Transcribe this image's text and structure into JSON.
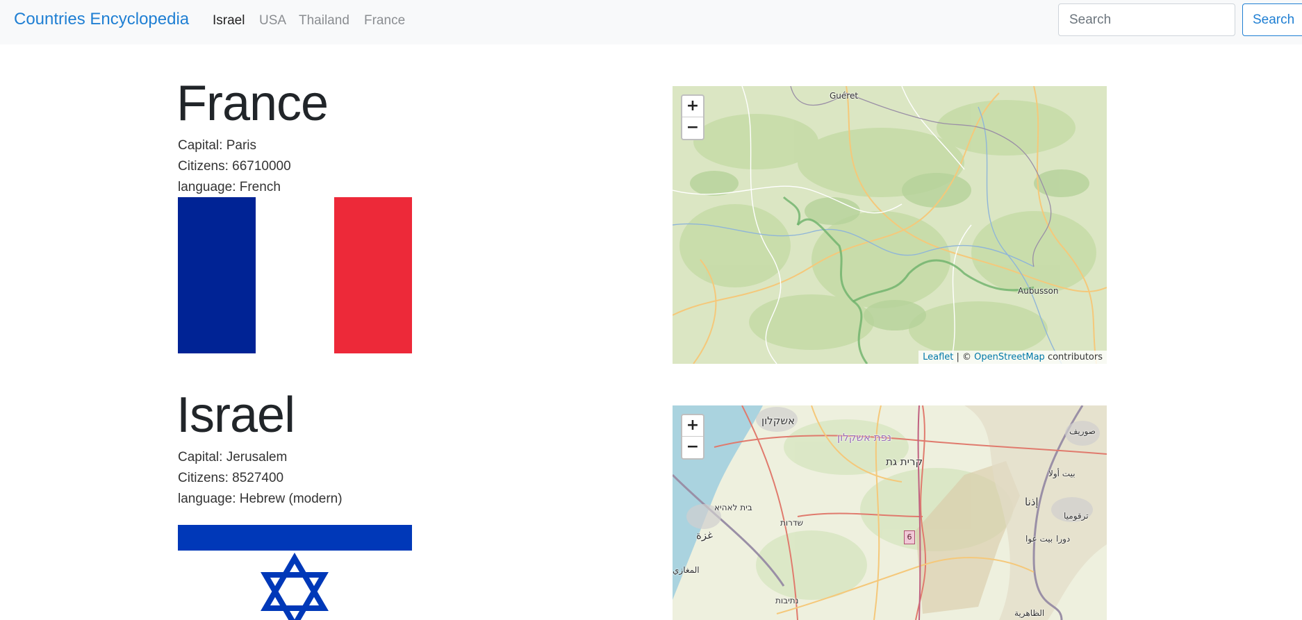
{
  "navbar": {
    "brand": "Countries Encyclopedia",
    "links": [
      "Israel",
      "USA",
      "Thailand",
      "France"
    ],
    "active_link": "Israel",
    "search_placeholder": "Search",
    "search_button": "Search"
  },
  "countries": [
    {
      "name": "France",
      "capital": "Capital: Paris",
      "citizens": "Citizens: 66710000",
      "language": "language: French",
      "flag_colors": {
        "blue": "#002395",
        "white": "#ffffff",
        "red": "#ed2939"
      },
      "map": {
        "zoom_in": "+",
        "zoom_out": "−",
        "places": [
          "Guéret",
          "Aubusson"
        ],
        "attribution": {
          "leaflet": "Leaflet",
          "separator": " | © ",
          "osm": "OpenStreetMap",
          "suffix": " contributors"
        }
      }
    },
    {
      "name": "Israel",
      "capital": "Capital: Jerusalem",
      "citizens": "Citizens: 8527400",
      "language": "language: Hebrew (modern)",
      "flag_colors": {
        "blue": "#0038b8",
        "white": "#ffffff"
      },
      "map": {
        "zoom_in": "+",
        "zoom_out": "−",
        "places": [
          "אשקלון",
          "נפת אשקלון",
          "קרית גת",
          "בית לאהיא",
          "שדרות",
          "غزة",
          "נתיבות",
          "صوريف",
          "بيت أولا",
          "إذنا",
          "ترقوميا",
          "بيت عوا",
          "دورا",
          "الظاهرية",
          "المغازي"
        ],
        "road_number": "6"
      }
    }
  ],
  "colors": {
    "brand": "#1f7fd3",
    "navbar_bg": "#f8f9fa",
    "map_land": "#dbe8c8",
    "map_sea": "#aad3df"
  }
}
